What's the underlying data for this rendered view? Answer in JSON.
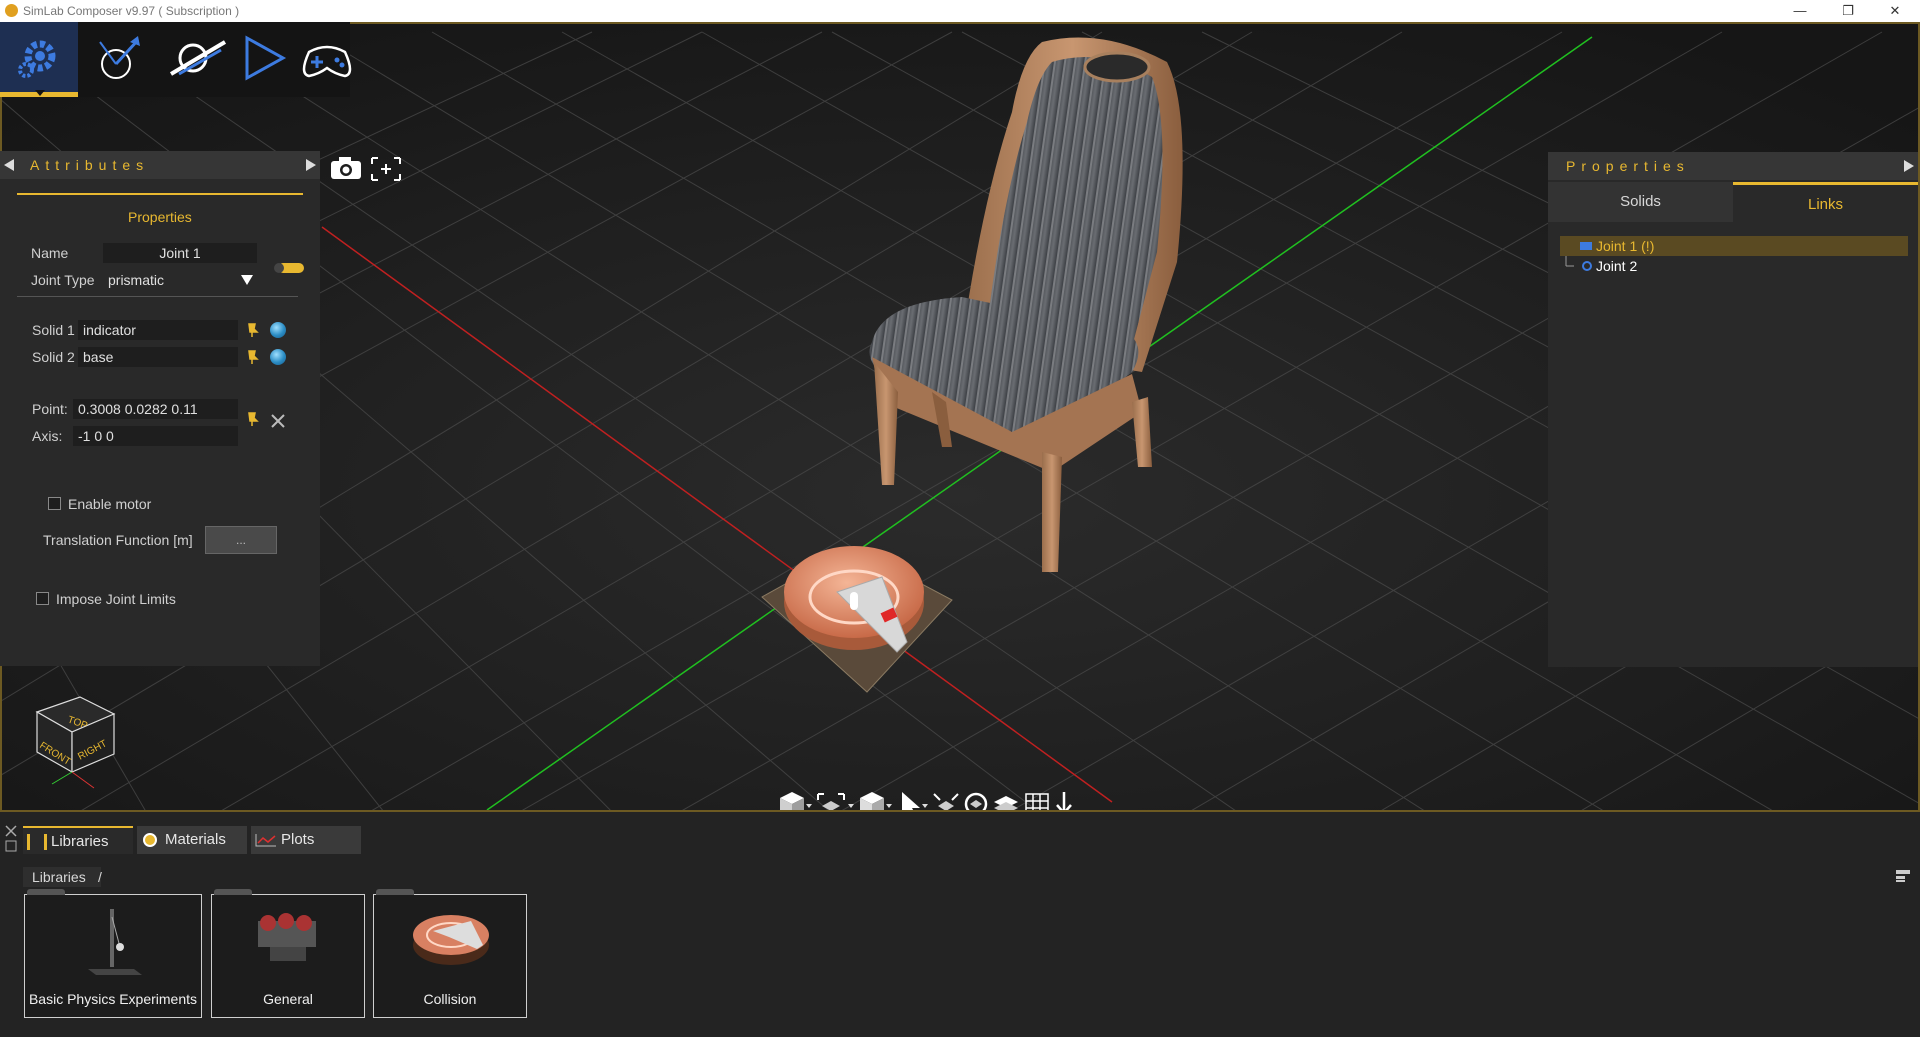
{
  "window": {
    "title": "SimLab Composer v9.97 ( Subscription )",
    "minimize": "—",
    "restore": "❐",
    "close": "✕"
  },
  "toolbar": {
    "items": [
      "settings-icon",
      "joint-icon",
      "link-icon",
      "play-icon",
      "gamepad-icon"
    ]
  },
  "attributes": {
    "title": "Attributes",
    "section": "Properties",
    "name_label": "Name",
    "name_value": "Joint 1",
    "joint_type_label": "Joint Type",
    "joint_type_value": "prismatic",
    "solid1_label": "Solid 1",
    "solid1_value": "indicator",
    "solid2_label": "Solid 2",
    "solid2_value": "base",
    "point_label": "Point:",
    "point_value": "0.3008 0.0282 0.11",
    "axis_label": "Axis:",
    "axis_value": "-1 0 0",
    "enable_motor_label": "Enable motor",
    "translation_label": "Translation Function [m]",
    "translation_button": "...",
    "limits_label": "Impose Joint Limits"
  },
  "properties": {
    "title": "Properties",
    "tabs": [
      "Solids",
      "Links"
    ],
    "tree": [
      "Joint 1 (!)",
      "Joint 2"
    ]
  },
  "view_cube": {
    "top": "TOP",
    "front": "FRONT",
    "right": "RIGHT"
  },
  "bottom": {
    "tabs": [
      "Libraries",
      "Materials",
      "Plots"
    ],
    "breadcrumb": "Libraries",
    "breadcrumb_sep": "/",
    "libraries": [
      "Basic Physics Experiments",
      "General",
      "Collision"
    ]
  },
  "colors": {
    "accent": "#e8b830",
    "panel": "#292929",
    "selection": "#5a4a22"
  }
}
